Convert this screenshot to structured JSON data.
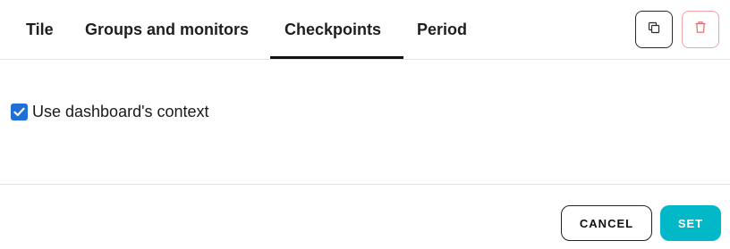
{
  "tabs": [
    {
      "label": "Tile"
    },
    {
      "label": "Groups and monitors"
    },
    {
      "label": "Checkpoints"
    },
    {
      "label": "Period"
    }
  ],
  "active_tab": "Checkpoints",
  "toolbar": {
    "copy_icon": "copy-icon",
    "delete_icon": "trash-icon",
    "delete_color": "#e36a6a"
  },
  "context": {
    "checkbox_label": "Use dashboard's context",
    "checked": true,
    "checkbox_color": "#1f6fd6"
  },
  "footer": {
    "cancel_label": "CANCEL",
    "set_label": "SET",
    "set_color": "#00b8c8"
  }
}
